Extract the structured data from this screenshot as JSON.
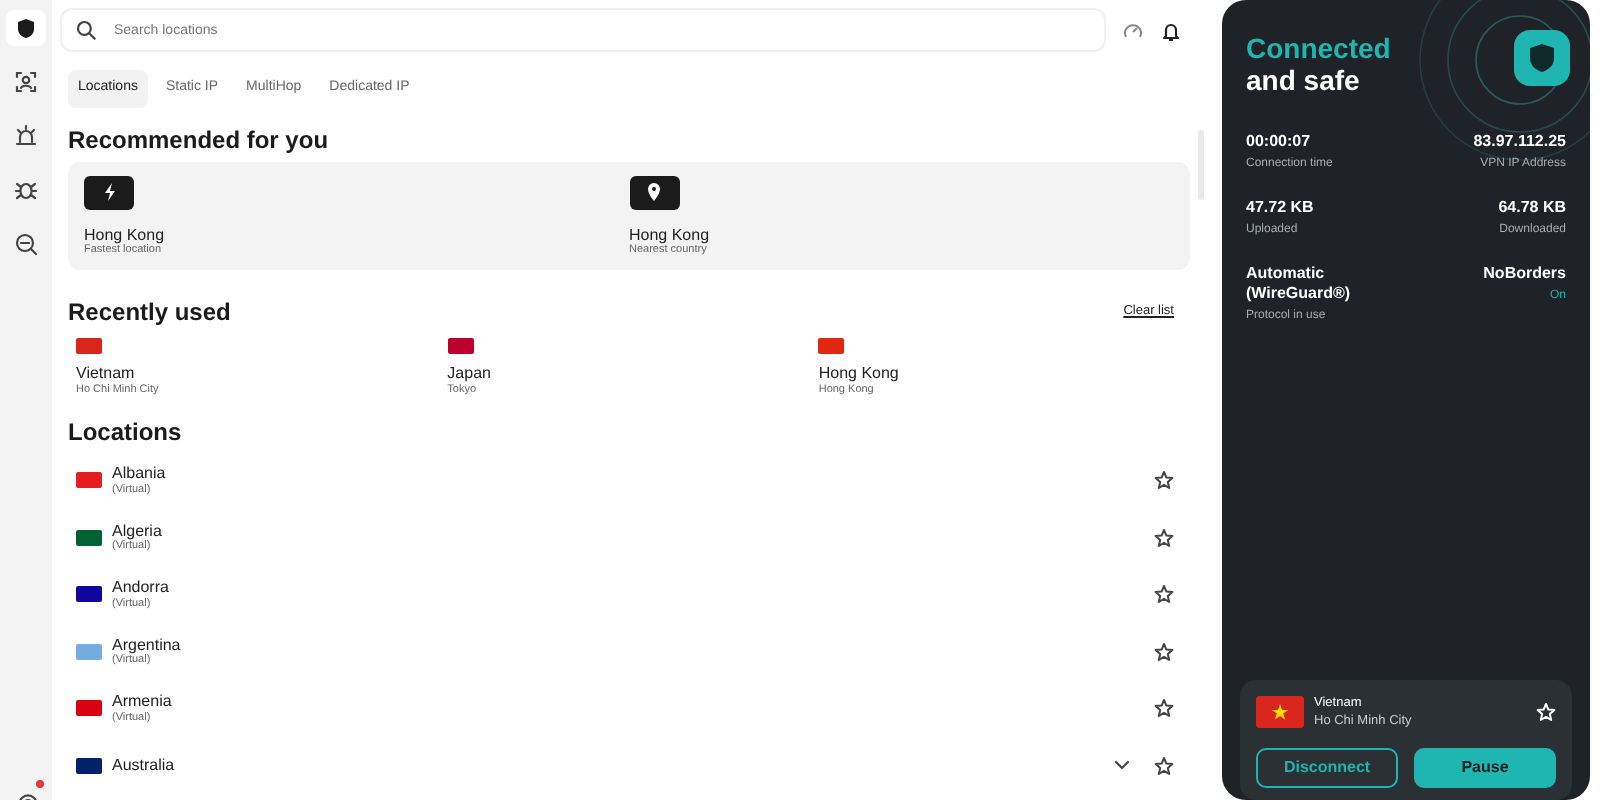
{
  "sidebar": {
    "items": [
      {
        "selected": true
      },
      {
        "selected": false
      },
      {
        "selected": false
      },
      {
        "selected": false
      },
      {
        "selected": false
      }
    ],
    "settings_alert": true
  },
  "search": {
    "placeholder": "Search locations"
  },
  "tabs": [
    {
      "label": "Locations",
      "selected": true
    },
    {
      "label": "Static IP",
      "selected": false
    },
    {
      "label": "MultiHop",
      "selected": false
    },
    {
      "label": "Dedicated IP",
      "selected": false
    }
  ],
  "recommended": {
    "title": "Recommended for you",
    "items": [
      {
        "kind": "fastest",
        "name": "Hong Kong",
        "subtitle": "Fastest location"
      },
      {
        "kind": "nearest",
        "name": "Hong Kong",
        "subtitle": "Nearest country"
      }
    ]
  },
  "recently_used": {
    "title": "Recently used",
    "action": "Clear list",
    "items": [
      {
        "name": "Vietnam",
        "city": "Ho Chi Minh City",
        "color": "#da251d"
      },
      {
        "name": "Japan",
        "city": "Tokyo",
        "color": "#bc002d"
      },
      {
        "name": "Hong Kong",
        "city": "Hong Kong",
        "color": "#de2910"
      }
    ]
  },
  "locations": {
    "title": "Locations",
    "items": [
      {
        "name": "Albania",
        "note": "(Virtual)",
        "color": "#e41e20",
        "favorite": false
      },
      {
        "name": "Algeria",
        "note": "(Virtual)",
        "color": "#006233",
        "favorite": false
      },
      {
        "name": "Andorra",
        "note": "(Virtual)",
        "color": "#10069f",
        "favorite": false
      },
      {
        "name": "Argentina",
        "note": "(Virtual)",
        "color": "#74acdf",
        "favorite": false
      },
      {
        "name": "Armenia",
        "note": "(Virtual)",
        "color": "#d90012",
        "favorite": false
      },
      {
        "name": "Australia",
        "color": "#012169",
        "favorite": false,
        "expandable": true
      }
    ]
  },
  "connection": {
    "status_line1": "Connected",
    "status_line2": "and safe",
    "stats": [
      {
        "value": "00:00:07",
        "label": "Connection time"
      },
      {
        "value": "83.97.112.25",
        "label": "VPN IP Address"
      },
      {
        "value": "47.72 KB",
        "label": "Uploaded"
      },
      {
        "value": "64.78 KB",
        "label": "Downloaded"
      },
      {
        "value": "Automatic (WireGuard®)",
        "label": "Protocol in use"
      },
      {
        "value": "NoBorders",
        "label": "On",
        "on": true
      }
    ],
    "current": {
      "country": "Vietnam",
      "city": "Ho Chi Minh City",
      "color": "#da251d",
      "favorite": false
    },
    "buttons": [
      {
        "kind": "outline",
        "label": "Disconnect"
      },
      {
        "kind": "filled",
        "label": "Pause"
      }
    ]
  }
}
